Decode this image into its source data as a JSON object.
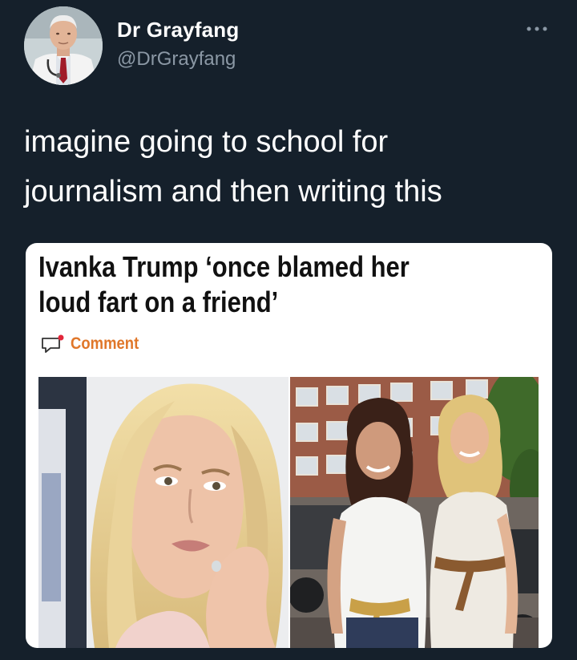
{
  "author": {
    "display_name": "Dr Grayfang",
    "handle": "@DrGrayfang",
    "avatar_icon": "doctor-portrait-avatar"
  },
  "tweet": {
    "text_line1": "imagine going to school for",
    "text_line2": "journalism and then writing this"
  },
  "more_icon": "more-horizontal-icon",
  "card": {
    "headline_line1": "Ivanka Trump ‘once blamed her",
    "headline_line2": "loud fart on a friend’",
    "comment_label": "Comment",
    "comment_icon": "comment-speech-bubble-icon",
    "comment_color": "#e0772a",
    "images": [
      "portrait-photo-woman-on-phone",
      "photo-two-women-posing-street"
    ]
  },
  "colors": {
    "background": "#15202b",
    "text": "#ffffff",
    "secondary_text": "#8b98a5",
    "card_background": "#ffffff"
  }
}
